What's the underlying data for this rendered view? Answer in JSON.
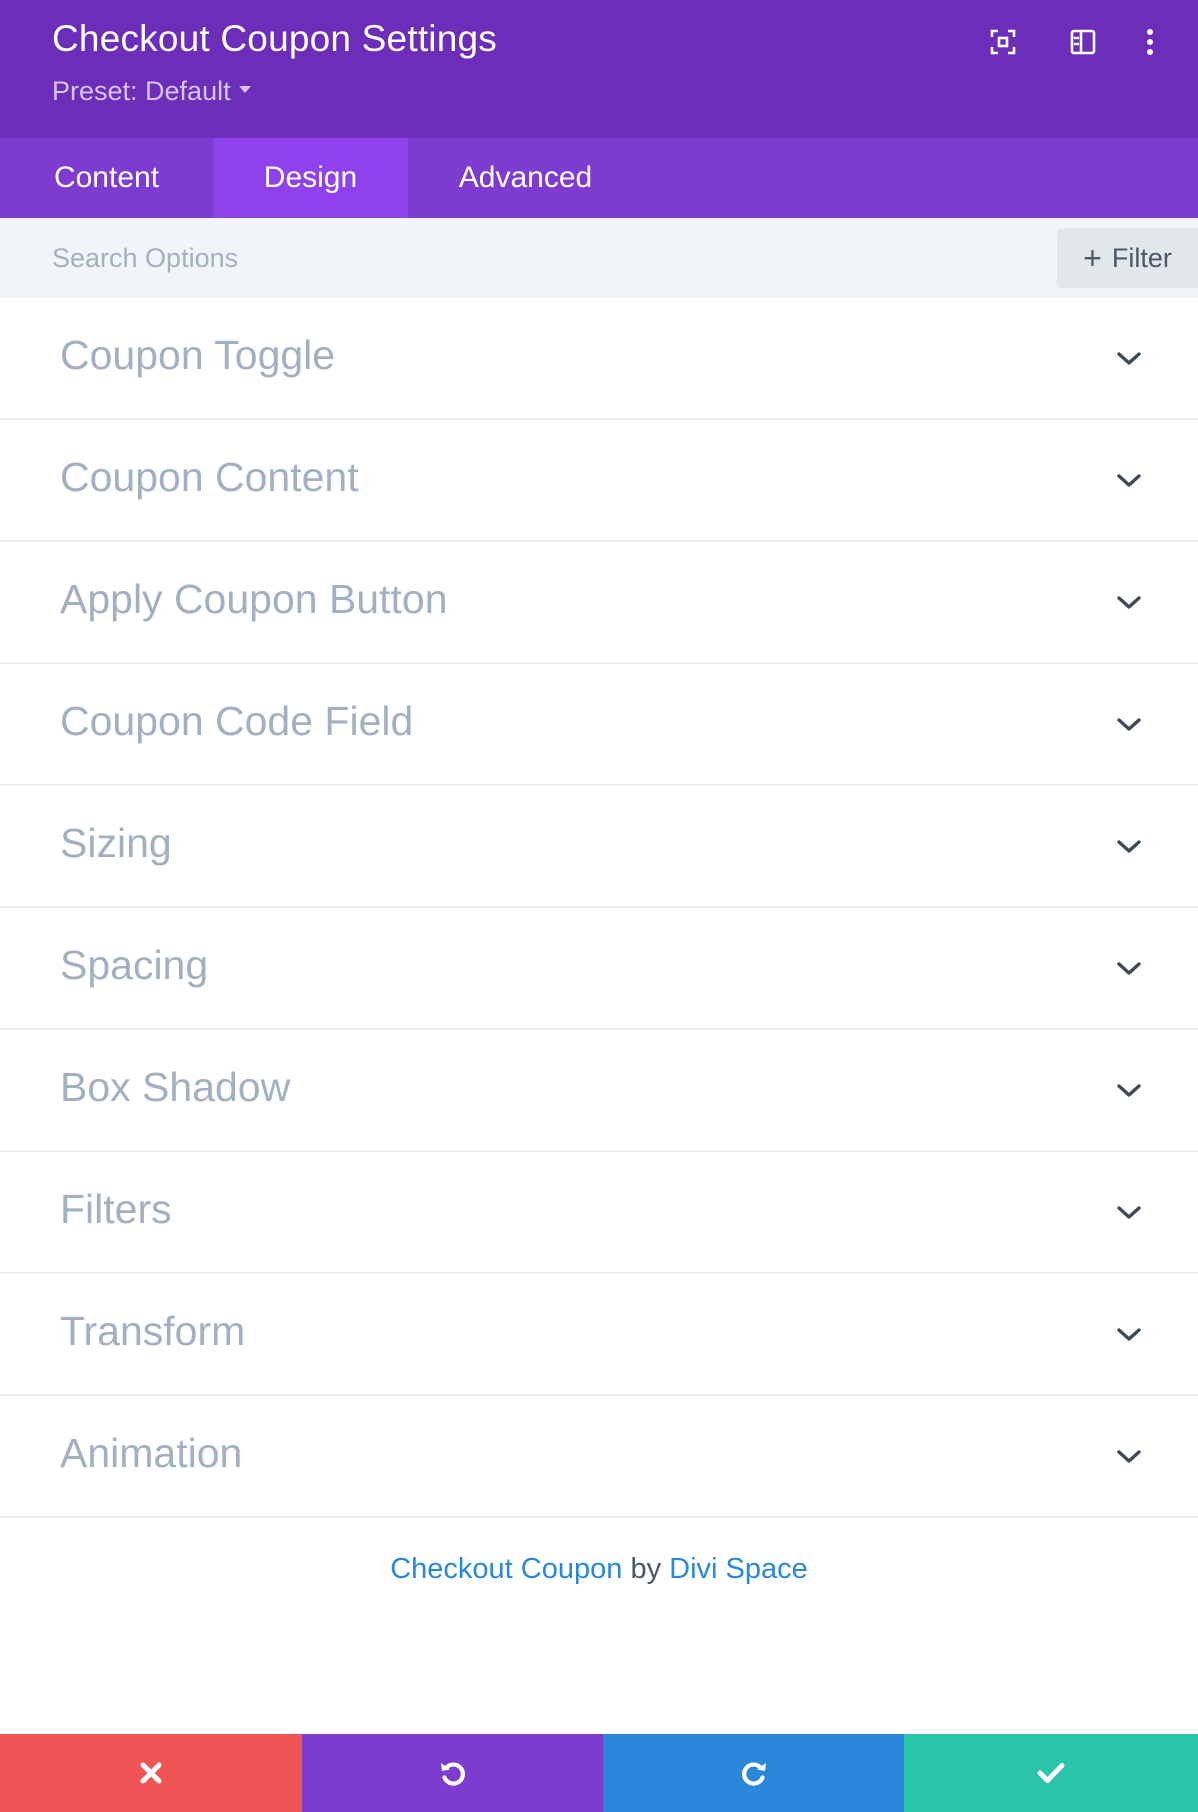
{
  "header": {
    "title": "Checkout Coupon Settings",
    "preset_label": "Preset: Default",
    "icons": [
      "fullscreen-icon",
      "sidebar-layout-icon",
      "more-options-icon"
    ]
  },
  "tabs": [
    {
      "label": "Content",
      "active": false
    },
    {
      "label": "Design",
      "active": true
    },
    {
      "label": "Advanced",
      "active": false
    }
  ],
  "search": {
    "placeholder": "Search Options",
    "value": "",
    "filter_label": "Filter"
  },
  "toggles": [
    {
      "label": "Coupon Toggle"
    },
    {
      "label": "Coupon Content"
    },
    {
      "label": "Apply Coupon Button"
    },
    {
      "label": "Coupon Code Field"
    },
    {
      "label": "Sizing"
    },
    {
      "label": "Spacing"
    },
    {
      "label": "Box Shadow"
    },
    {
      "label": "Filters"
    },
    {
      "label": "Transform"
    },
    {
      "label": "Animation"
    }
  ],
  "credit": {
    "module_name": "Checkout Coupon",
    "by": "by",
    "author": "Divi Space"
  },
  "footer": {
    "buttons": [
      "cancel-icon",
      "undo-icon",
      "redo-icon",
      "save-icon"
    ]
  },
  "colors": {
    "header_bg": "#6c2eb9",
    "tabs_bg": "#7e3bd0",
    "tab_active_bg": "#8f42ec",
    "cancel": "#ef5555",
    "undo": "#7d3bcf",
    "redo": "#2b87da",
    "save": "#29c4a9",
    "link": "#2b87da"
  }
}
